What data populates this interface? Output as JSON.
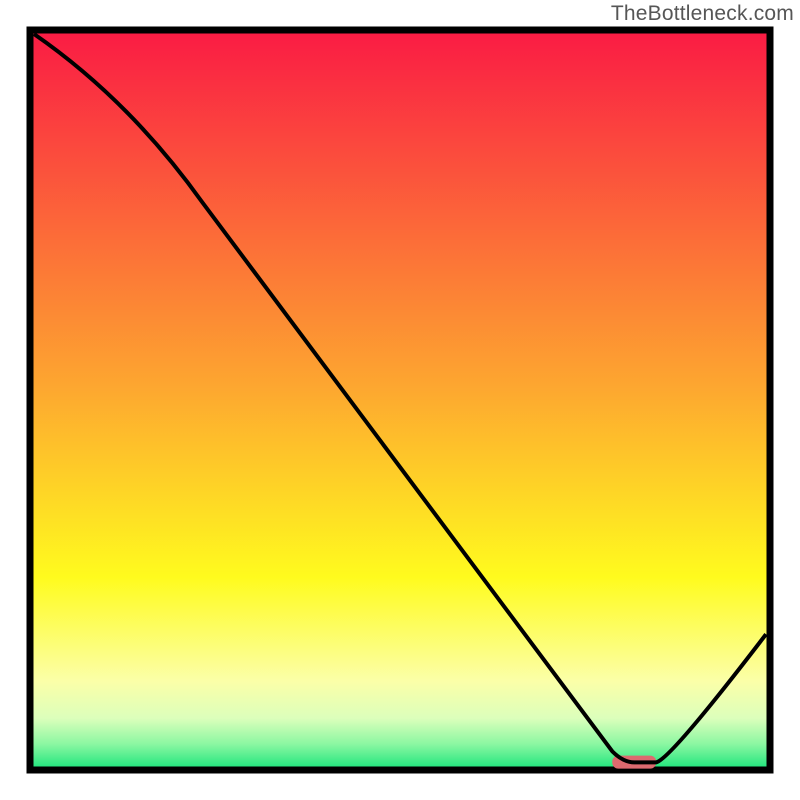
{
  "attribution": "TheBottleneck.com",
  "chart_data": {
    "type": "line",
    "title": "",
    "xlabel": "",
    "ylabel": "",
    "x": [
      0,
      23,
      79,
      82,
      85,
      100
    ],
    "values": [
      100,
      77,
      2,
      0.5,
      0.5,
      18
    ],
    "ylim": [
      0,
      100
    ],
    "xlim": [
      0,
      100
    ],
    "flat_marker": {
      "x_start": 79,
      "x_end": 85,
      "y": 0.6,
      "color": "#dd6a6f"
    },
    "gradient_stops": [
      {
        "offset": 0.0,
        "color": "#fa1b44"
      },
      {
        "offset": 0.48,
        "color": "#fda630"
      },
      {
        "offset": 0.74,
        "color": "#fffb1e"
      },
      {
        "offset": 0.88,
        "color": "#fbffa8"
      },
      {
        "offset": 0.93,
        "color": "#dcffbb"
      },
      {
        "offset": 0.965,
        "color": "#8bf7a2"
      },
      {
        "offset": 1.0,
        "color": "#18e47a"
      }
    ]
  }
}
